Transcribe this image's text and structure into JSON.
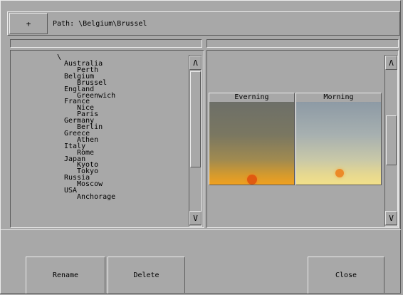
{
  "toolbar": {
    "plus_label": "+",
    "path_label": "Path: \\Belgium\\Brussel"
  },
  "tree": {
    "root": "\\",
    "items": [
      {
        "label": "Australia",
        "level": 0
      },
      {
        "label": "Perth",
        "level": 1
      },
      {
        "label": "Belgium",
        "level": 0
      },
      {
        "label": "Brussel",
        "level": 1
      },
      {
        "label": "England",
        "level": 0
      },
      {
        "label": "Greenwich",
        "level": 1
      },
      {
        "label": "France",
        "level": 0
      },
      {
        "label": "Nice",
        "level": 1
      },
      {
        "label": "Paris",
        "level": 1
      },
      {
        "label": "Germany",
        "level": 0
      },
      {
        "label": "Berlin",
        "level": 1
      },
      {
        "label": "Greece",
        "level": 0
      },
      {
        "label": "Athen",
        "level": 1
      },
      {
        "label": "Italy",
        "level": 0
      },
      {
        "label": "Rome",
        "level": 1
      },
      {
        "label": "Japan",
        "level": 0
      },
      {
        "label": "Kyoto",
        "level": 1
      },
      {
        "label": "Tokyo",
        "level": 1
      },
      {
        "label": "Russia",
        "level": 0
      },
      {
        "label": "Moscow",
        "level": 1
      },
      {
        "label": "USA",
        "level": 0
      },
      {
        "label": "Anchorage",
        "level": 1
      }
    ]
  },
  "scroll": {
    "up_icon": "up-arrow",
    "down_icon": "down-arrow",
    "up_glyph": "Λ",
    "down_glyph": "V"
  },
  "thumbnails": [
    {
      "title": "Everning",
      "scene": "sunset"
    },
    {
      "title": "Morning",
      "scene": "sunrise"
    }
  ],
  "buttons": {
    "rename": "Rename",
    "delete": "Delete",
    "close": "Close"
  },
  "colors": {
    "panel": "#a8a8a8",
    "highlight": "#ececec",
    "shadow": "#5c5c5c"
  }
}
